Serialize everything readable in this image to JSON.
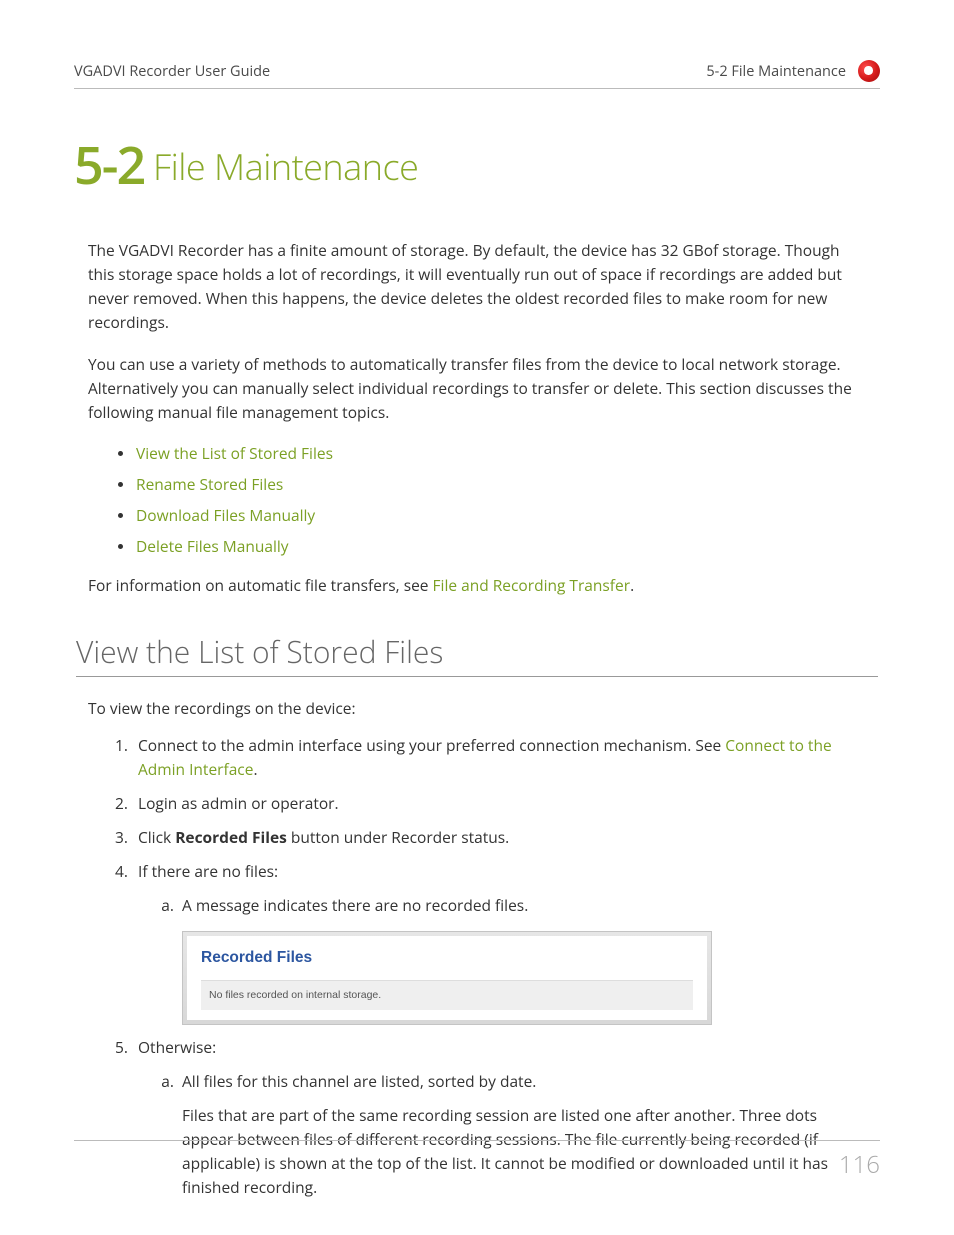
{
  "header": {
    "left": "VGADVI Recorder User Guide",
    "right": "5-2 File Maintenance"
  },
  "title_num": "5-2",
  "title_text": " File Maintenance",
  "para1": "The VGADVI Recorder has a finite amount of storage. By default, the device has 32 GBof storage. Though this storage space holds a lot of recordings, it will eventually run out of space if recordings are added but never removed. When this happens, the device deletes the oldest recorded files to make room for new recordings.",
  "para2": "You can use a variety of methods to automatically transfer files from the device to local network storage. Alternatively you can manually select individual recordings to transfer or delete. This section discusses the following manual file management topics.",
  "links": [
    "View the List of Stored Files",
    "Rename Stored Files",
    "Download Files Manually",
    "Delete Files Manually"
  ],
  "para3_a": "For information on automatic file transfers, see ",
  "para3_link": "File and Recording Transfer",
  "para3_b": ".",
  "h2": "View the List of Stored Files",
  "intro": "To view the recordings on the device:",
  "step1_a": "Connect to the admin interface using your preferred connection mechanism. See ",
  "step1_link": "Connect to the Admin Interface",
  "step1_b": ".",
  "step2": "Login as admin or operator.",
  "step3_a": "Click ",
  "step3_bold": "Recorded Files",
  "step3_b": " button under Recorder status.",
  "step4": "If there are no files:",
  "step4a": "A message indicates there are no recorded files.",
  "shot": {
    "title": "Recorded Files",
    "msg": "No files recorded on internal storage."
  },
  "step5": "Otherwise:",
  "step5a": "All files for this channel are listed, sorted by date.",
  "step5a_p": "Files that are part of the same recording session are listed one after another. Three dots appear between files of different recording sessions. The file currently being recorded (if applicable) is shown at the top of the list. It cannot be modified or downloaded until it has finished recording.",
  "page_number": "116"
}
